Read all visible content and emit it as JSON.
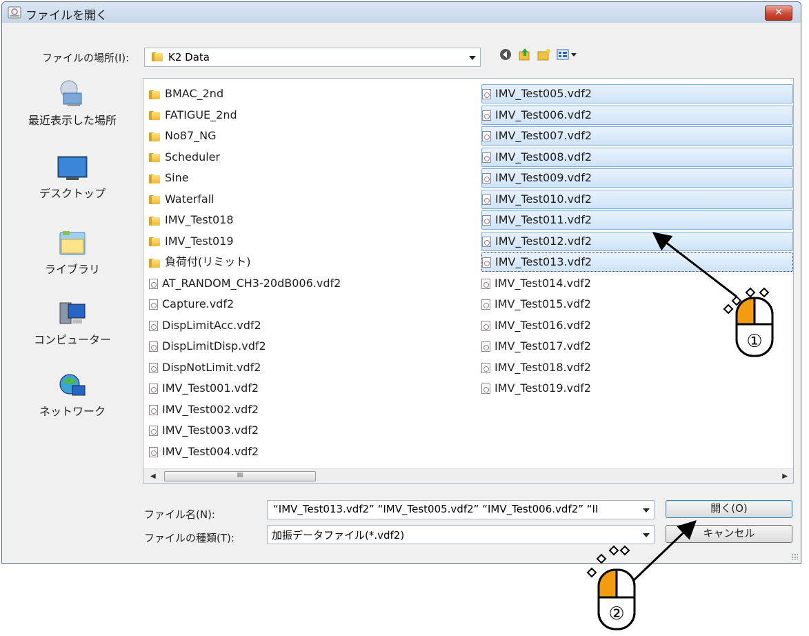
{
  "window": {
    "title": "ファイルを開く",
    "close_label": "✕"
  },
  "location": {
    "label": "ファイルの場所(I):",
    "value": "K2 Data"
  },
  "places": [
    {
      "label": "最近表示した場所",
      "icon": "recent-places-icon"
    },
    {
      "label": "デスクトップ",
      "icon": "desktop-icon"
    },
    {
      "label": "ライブラリ",
      "icon": "libraries-icon"
    },
    {
      "label": "コンピューター",
      "icon": "computer-icon"
    },
    {
      "label": "ネットワーク",
      "icon": "network-icon"
    }
  ],
  "files": {
    "column1": [
      {
        "name": "BMAC_2nd",
        "type": "folder"
      },
      {
        "name": "FATIGUE_2nd",
        "type": "folder"
      },
      {
        "name": "No87_NG",
        "type": "folder"
      },
      {
        "name": "Scheduler",
        "type": "folder"
      },
      {
        "name": "Sine",
        "type": "folder"
      },
      {
        "name": "Waterfall",
        "type": "folder"
      },
      {
        "name": "IMV_Test018",
        "type": "folder"
      },
      {
        "name": "IMV_Test019",
        "type": "folder"
      },
      {
        "name": "負荷付(リミット)",
        "type": "folder"
      },
      {
        "name": "AT_RANDOM_CH3-20dB006.vdf2",
        "type": "file"
      },
      {
        "name": "Capture.vdf2",
        "type": "file"
      },
      {
        "name": "DispLimitAcc.vdf2",
        "type": "file"
      },
      {
        "name": "DispLimitDisp.vdf2",
        "type": "file"
      },
      {
        "name": "DispNotLimit.vdf2",
        "type": "file"
      },
      {
        "name": "IMV_Test001.vdf2",
        "type": "file"
      },
      {
        "name": "IMV_Test002.vdf2",
        "type": "file"
      },
      {
        "name": "IMV_Test003.vdf2",
        "type": "file"
      },
      {
        "name": "IMV_Test004.vdf2",
        "type": "file"
      }
    ],
    "column2": [
      {
        "name": "IMV_Test005.vdf2",
        "type": "file",
        "selected": true
      },
      {
        "name": "IMV_Test006.vdf2",
        "type": "file",
        "selected": true
      },
      {
        "name": "IMV_Test007.vdf2",
        "type": "file",
        "selected": true
      },
      {
        "name": "IMV_Test008.vdf2",
        "type": "file",
        "selected": true
      },
      {
        "name": "IMV_Test009.vdf2",
        "type": "file",
        "selected": true
      },
      {
        "name": "IMV_Test010.vdf2",
        "type": "file",
        "selected": true
      },
      {
        "name": "IMV_Test011.vdf2",
        "type": "file",
        "selected": true
      },
      {
        "name": "IMV_Test012.vdf2",
        "type": "file",
        "selected": true
      },
      {
        "name": "IMV_Test013.vdf2",
        "type": "file",
        "selected": true,
        "focused": true
      },
      {
        "name": "IMV_Test014.vdf2",
        "type": "file"
      },
      {
        "name": "IMV_Test015.vdf2",
        "type": "file"
      },
      {
        "name": "IMV_Test016.vdf2",
        "type": "file"
      },
      {
        "name": "IMV_Test017.vdf2",
        "type": "file"
      },
      {
        "name": "IMV_Test018.vdf2",
        "type": "file"
      },
      {
        "name": "IMV_Test019.vdf2",
        "type": "file"
      }
    ]
  },
  "scrollbar": {
    "thumb_label": "III"
  },
  "filename": {
    "label": "ファイル名(N):",
    "value": "“IMV_Test013.vdf2” “IMV_Test005.vdf2” “IMV_Test006.vdf2” “II"
  },
  "filetype": {
    "label": "ファイルの種類(T):",
    "value": "加振データファイル(*.vdf2)"
  },
  "buttons": {
    "open": "開く(O)",
    "cancel": "キャンセル"
  },
  "annotations": {
    "step1": "①",
    "step2": "②"
  },
  "colors": {
    "mouse_accent": "#f39c12",
    "selection": "#cfe3f8"
  }
}
